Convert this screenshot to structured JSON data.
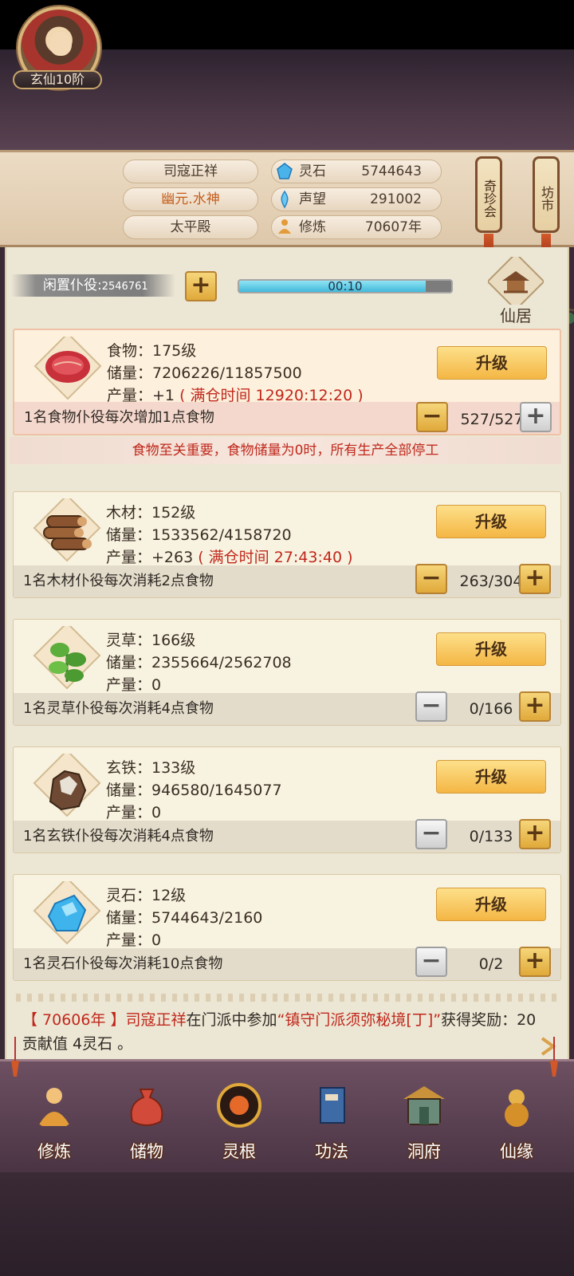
{
  "header": {
    "player_name": "司寇正祥",
    "title": "幽元.水神",
    "location": "太平殿",
    "rank": "玄仙10阶",
    "stats": [
      {
        "label": "灵石",
        "value": "5744643"
      },
      {
        "label": "声望",
        "value": "291002"
      },
      {
        "label": "修炼",
        "value": "70607年"
      }
    ],
    "lanterns": [
      "奇珍会",
      "坊市"
    ]
  },
  "idle": {
    "label": "闲置仆役:",
    "count": "2546761",
    "timer": "00:10",
    "progress": 0.88,
    "house_label": "仙居"
  },
  "resources": [
    {
      "name": "食物：175级",
      "storage": "储量：7206226/11857500",
      "output": "产量：+1",
      "full_time": "( 满仓时间 12920:12:20 )",
      "upgrade": "升级",
      "desc": "1名食物仆役每次增加1点食物",
      "count": "527/527",
      "icon": "meat-icon"
    },
    {
      "name": "木材：152级",
      "storage": "储量：1533562/4158720",
      "output": "产量：+263",
      "full_time": "( 满仓时间 27:43:40 )",
      "upgrade": "升级",
      "desc": "1名木材仆役每次消耗2点食物",
      "count": "263/304",
      "icon": "wood-icon"
    },
    {
      "name": "灵草：166级",
      "storage": "储量：2355664/2562708",
      "output": "产量：0",
      "full_time": "",
      "upgrade": "升级",
      "desc": "1名灵草仆役每次消耗4点食物",
      "count": "0/166",
      "icon": "herb-icon"
    },
    {
      "name": "玄铁：133级",
      "storage": "储量：946580/1645077",
      "output": "产量：0",
      "full_time": "",
      "upgrade": "升级",
      "desc": "1名玄铁仆役每次消耗4点食物",
      "count": "0/133",
      "icon": "iron-ore-icon"
    },
    {
      "name": "灵石：12级",
      "storage": "储量：5744643/2160",
      "output": "产量：0",
      "full_time": "",
      "upgrade": "升级",
      "desc": "1名灵石仆役每次消耗10点食物",
      "count": "0/2",
      "icon": "spirit-stone-icon"
    }
  ],
  "warning": "食物至关重要，食物储量为0时，所有生产全部停工",
  "log": {
    "year": "【 70606年 】",
    "name": "司寇正祥",
    "text1": "在门派中参加",
    "quest": "“镇守门派须弥秘境[丁]”",
    "text2": "获得奖励：20贡献值 4灵石 。"
  },
  "nav": [
    "修炼",
    "储物",
    "灵根",
    "功法",
    "洞府",
    "仙缘"
  ],
  "colors": {
    "accent_red": "#c0281c",
    "button_gold": "#f4b644",
    "panel_bg": "#ece6d4",
    "nav_bg": "#6d5062"
  }
}
